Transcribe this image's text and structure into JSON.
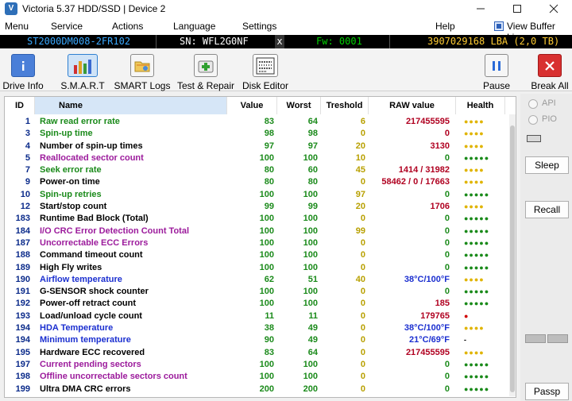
{
  "title_bar": {
    "title": "Victoria 5.37 HDD/SSD | Device 2",
    "min_icon": "minimize-icon",
    "max_icon": "maximize-icon",
    "close_icon": "close-icon"
  },
  "menu": {
    "items": [
      "Menu",
      "Service",
      "Actions",
      "Language",
      "Settings",
      "Help"
    ],
    "view_buffer_live": "View Buffer Live"
  },
  "device": {
    "model": "ST2000DM008-2FR102",
    "serial": "SN: WFL2G0NF",
    "close": "x",
    "firmware": "Fw: 0001",
    "lba": "3907029168 LBA (2,0 TB)"
  },
  "toolbar": {
    "drive_info": "Drive Info",
    "smart": "S.M.A.R.T",
    "smart_logs": "SMART Logs",
    "test_repair": "Test & Repair",
    "disk_editor": "Disk Editor",
    "pause": "Pause",
    "break_all": "Break All"
  },
  "table": {
    "headers": {
      "id": "ID",
      "name": "Name",
      "value": "Value",
      "worst": "Worst",
      "treshold": "Treshold",
      "raw": "RAW value",
      "health": "Health"
    },
    "rows": [
      {
        "id": "1",
        "name": "Raw read error rate",
        "value": "83",
        "worst": "64",
        "tresh": "6",
        "raw": "217455595",
        "health": "●●●●",
        "name_color": "#1a8a1a",
        "raw_color": "#b00020",
        "health_color": "#e0b400"
      },
      {
        "id": "3",
        "name": "Spin-up time",
        "value": "98",
        "worst": "98",
        "tresh": "0",
        "raw": "0",
        "health": "●●●●",
        "name_color": "#1a8a1a",
        "raw_color": "#b00020",
        "health_color": "#e0b400"
      },
      {
        "id": "4",
        "name": "Number of spin-up times",
        "value": "97",
        "worst": "97",
        "tresh": "20",
        "raw": "3130",
        "health": "●●●●",
        "name_color": "#000000",
        "raw_color": "#b00020",
        "health_color": "#e0b400"
      },
      {
        "id": "5",
        "name": "Reallocated sector count",
        "value": "100",
        "worst": "100",
        "tresh": "10",
        "raw": "0",
        "health": "●●●●●",
        "name_color": "#9c1b9c",
        "raw_color": "#1a8a1a",
        "health_color": "#1a8a1a"
      },
      {
        "id": "7",
        "name": "Seek error rate",
        "value": "80",
        "worst": "60",
        "tresh": "45",
        "raw": "1414 / 31982",
        "health": "●●●●",
        "name_color": "#1a8a1a",
        "raw_color": "#b00020",
        "health_color": "#e0b400"
      },
      {
        "id": "9",
        "name": "Power-on time",
        "value": "80",
        "worst": "80",
        "tresh": "0",
        "raw": "58462 / 0 / 17663",
        "health": "●●●●",
        "name_color": "#000000",
        "raw_color": "#b00020",
        "health_color": "#e0b400"
      },
      {
        "id": "10",
        "name": "Spin-up retries",
        "value": "100",
        "worst": "100",
        "tresh": "97",
        "raw": "0",
        "health": "●●●●●",
        "name_color": "#1a8a1a",
        "raw_color": "#1a8a1a",
        "health_color": "#1a8a1a"
      },
      {
        "id": "12",
        "name": "Start/stop count",
        "value": "99",
        "worst": "99",
        "tresh": "20",
        "raw": "1706",
        "health": "●●●●",
        "name_color": "#000000",
        "raw_color": "#b00020",
        "health_color": "#e0b400"
      },
      {
        "id": "183",
        "name": "Runtime Bad Block (Total)",
        "value": "100",
        "worst": "100",
        "tresh": "0",
        "raw": "0",
        "health": "●●●●●",
        "name_color": "#000000",
        "raw_color": "#1a8a1a",
        "health_color": "#1a8a1a"
      },
      {
        "id": "184",
        "name": "I/O CRC Error Detection Count Total",
        "value": "100",
        "worst": "100",
        "tresh": "99",
        "raw": "0",
        "health": "●●●●●",
        "name_color": "#9c1b9c",
        "raw_color": "#1a8a1a",
        "health_color": "#1a8a1a"
      },
      {
        "id": "187",
        "name": "Uncorrectable ECC Errors",
        "value": "100",
        "worst": "100",
        "tresh": "0",
        "raw": "0",
        "health": "●●●●●",
        "name_color": "#9c1b9c",
        "raw_color": "#1a8a1a",
        "health_color": "#1a8a1a"
      },
      {
        "id": "188",
        "name": "Command timeout count",
        "value": "100",
        "worst": "100",
        "tresh": "0",
        "raw": "0",
        "health": "●●●●●",
        "name_color": "#000000",
        "raw_color": "#1a8a1a",
        "health_color": "#1a8a1a"
      },
      {
        "id": "189",
        "name": "High Fly writes",
        "value": "100",
        "worst": "100",
        "tresh": "0",
        "raw": "0",
        "health": "●●●●●",
        "name_color": "#000000",
        "raw_color": "#1a8a1a",
        "health_color": "#1a8a1a"
      },
      {
        "id": "190",
        "name": "Airflow temperature",
        "value": "62",
        "worst": "51",
        "tresh": "40",
        "raw": "38°C/100°F",
        "health": "●●●●",
        "name_color": "#1b2fd0",
        "raw_color": "#1b2fd0",
        "health_color": "#e0b400"
      },
      {
        "id": "191",
        "name": "G-SENSOR shock counter",
        "value": "100",
        "worst": "100",
        "tresh": "0",
        "raw": "0",
        "health": "●●●●●",
        "name_color": "#000000",
        "raw_color": "#1a8a1a",
        "health_color": "#1a8a1a"
      },
      {
        "id": "192",
        "name": "Power-off retract count",
        "value": "100",
        "worst": "100",
        "tresh": "0",
        "raw": "185",
        "health": "●●●●●",
        "name_color": "#000000",
        "raw_color": "#b00020",
        "health_color": "#1a8a1a"
      },
      {
        "id": "193",
        "name": "Load/unload cycle count",
        "value": "11",
        "worst": "11",
        "tresh": "0",
        "raw": "179765",
        "health": "●",
        "name_color": "#000000",
        "raw_color": "#b00020",
        "health_color": "#d00000"
      },
      {
        "id": "194",
        "name": "HDA Temperature",
        "value": "38",
        "worst": "49",
        "tresh": "0",
        "raw": "38°C/100°F",
        "health": "●●●●",
        "name_color": "#1b2fd0",
        "raw_color": "#1b2fd0",
        "health_color": "#e0b400"
      },
      {
        "id": "194",
        "name": "Minimum temperature",
        "value": "90",
        "worst": "49",
        "tresh": "0",
        "raw": "21°C/69°F",
        "health": "-",
        "name_color": "#1b2fd0",
        "raw_color": "#1b2fd0",
        "health_color": "#000000"
      },
      {
        "id": "195",
        "name": "Hardware ECC recovered",
        "value": "83",
        "worst": "64",
        "tresh": "0",
        "raw": "217455595",
        "health": "●●●●",
        "name_color": "#000000",
        "raw_color": "#b00020",
        "health_color": "#e0b400"
      },
      {
        "id": "197",
        "name": "Current pending sectors",
        "value": "100",
        "worst": "100",
        "tresh": "0",
        "raw": "0",
        "health": "●●●●●",
        "name_color": "#9c1b9c",
        "raw_color": "#1a8a1a",
        "health_color": "#1a8a1a"
      },
      {
        "id": "198",
        "name": "Offline uncorrectable sectors count",
        "value": "100",
        "worst": "100",
        "tresh": "0",
        "raw": "0",
        "health": "●●●●●",
        "name_color": "#9c1b9c",
        "raw_color": "#1a8a1a",
        "health_color": "#1a8a1a"
      },
      {
        "id": "199",
        "name": "Ultra DMA CRC errors",
        "value": "200",
        "worst": "200",
        "tresh": "0",
        "raw": "0",
        "health": "●●●●●",
        "name_color": "#000000",
        "raw_color": "#1a8a1a",
        "health_color": "#1a8a1a"
      }
    ]
  },
  "right_panel": {
    "api": "API",
    "pio": "PIO",
    "sleep": "Sleep",
    "recall": "Recall",
    "passp": "Passp"
  }
}
